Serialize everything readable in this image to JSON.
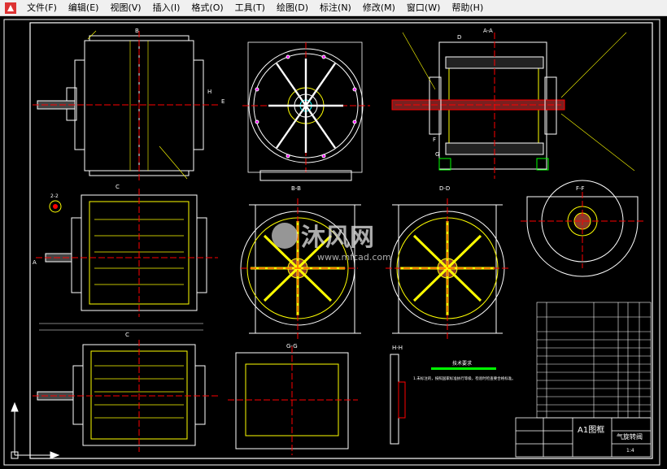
{
  "menu": {
    "items": [
      "文件(F)",
      "编辑(E)",
      "视图(V)",
      "插入(I)",
      "格式(O)",
      "工具(T)",
      "绘图(D)",
      "标注(N)",
      "修改(M)",
      "窗口(W)",
      "帮助(H)"
    ]
  },
  "views": {
    "b_label": "B",
    "bb_label": "B-B",
    "dd_label": "D-D",
    "aa_label": "A-A",
    "ff_label": "F-F",
    "c_label": "C",
    "gg_label": "G-G",
    "hh_label": "H-H",
    "d_marker": "D",
    "e_marker": "E",
    "h_marker": "H",
    "f_marker": "F",
    "g_marker": "G",
    "c_marker": "C",
    "a_marker": "A",
    "detail_label": "2-2"
  },
  "notes": {
    "title": "技术要求",
    "line1": "1.未标注的，按照国家标准执行等级，检验时检查要合格标准。"
  },
  "title_block": {
    "sheet_size": "A1图框",
    "drawing_name": "气旋转阀",
    "scale": "1:4"
  },
  "watermark": {
    "brand": "沐风网",
    "url": "www.mfcad.com"
  },
  "colors": {
    "background": "#000000",
    "line_white": "#ffffff",
    "line_yellow": "#ffff00",
    "line_red": "#ff0000",
    "line_green": "#00ff00",
    "line_cyan": "#00ffff",
    "line_magenta": "#ff00ff"
  }
}
